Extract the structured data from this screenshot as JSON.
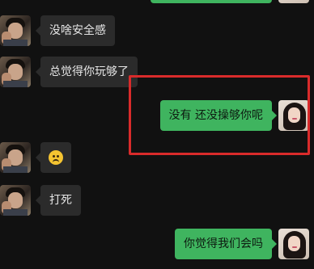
{
  "messages": [
    {
      "side": "in",
      "text": "没啥安全感"
    },
    {
      "side": "in",
      "text": "总觉得你玩够了"
    },
    {
      "side": "out",
      "text": "没有 还没操够你呢"
    },
    {
      "side": "in",
      "emoji": "frowning-face"
    },
    {
      "side": "in",
      "text": "打死"
    },
    {
      "side": "out",
      "text": "你觉得我们会吗"
    }
  ],
  "colors": {
    "background": "#111111",
    "incoming_bubble": "#2b2b2b",
    "outgoing_bubble": "#3fb45f",
    "highlight": "#d92b2b"
  }
}
